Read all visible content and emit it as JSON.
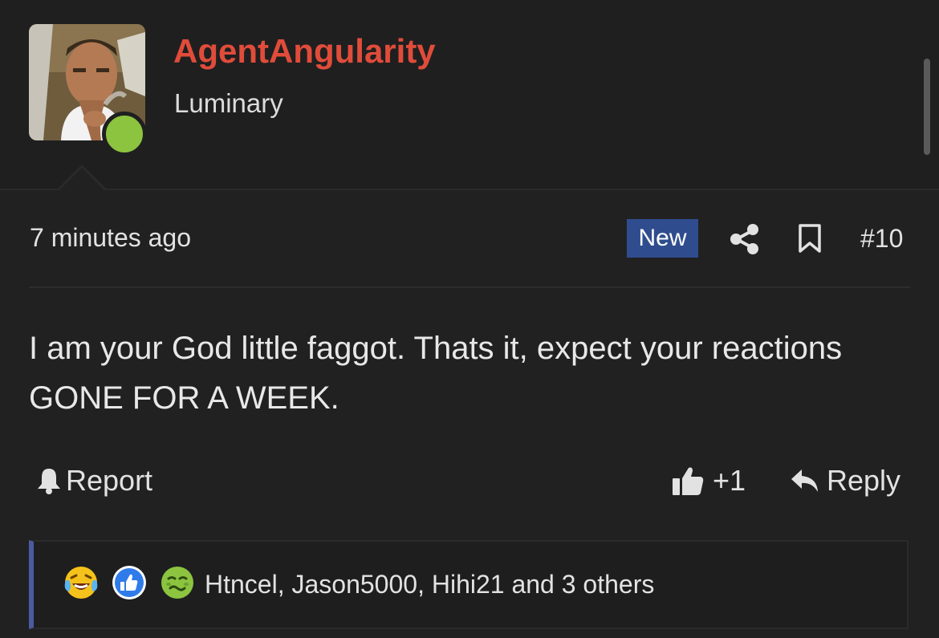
{
  "post": {
    "username": "AgentAngularity",
    "user_title": "Luminary",
    "timestamp": "7 minutes ago",
    "new_badge": "New",
    "post_number": "#10",
    "message": "I am your God little faggot. Thats it, expect your reactions GONE FOR A WEEK.",
    "status": "online",
    "online_color": "#8cc43f",
    "username_color": "#e04c3a",
    "badge_color": "#2f4d8e"
  },
  "actions": {
    "report_label": "Report",
    "like_count": "+1",
    "reply_label": "Reply"
  },
  "reactions": {
    "icons": [
      "crying-laughing-emoji-icon",
      "like-reaction-icon",
      "nauseated-emoji-icon"
    ],
    "summary": "Htncel, Jason5000, Hihi21 and 3 others"
  },
  "icons": {
    "share": "share-icon",
    "bookmark": "bookmark-icon",
    "report": "bell-icon",
    "like": "thumbs-up-icon",
    "reply": "reply-arrow-icon"
  }
}
